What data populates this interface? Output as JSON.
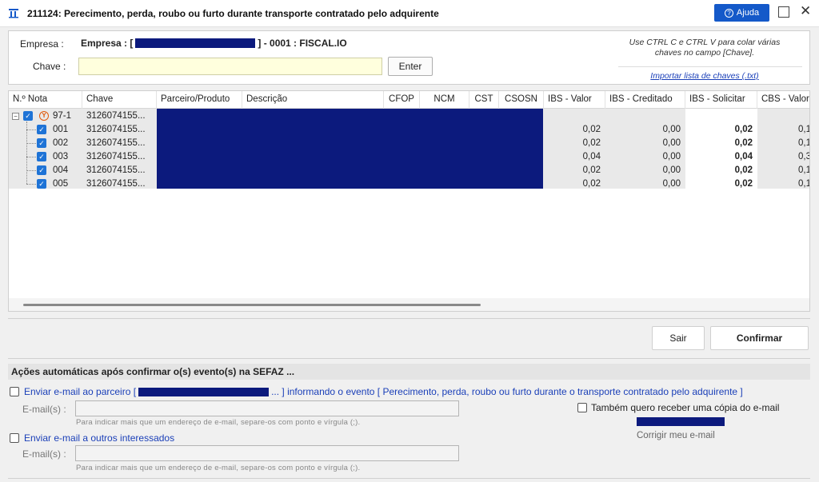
{
  "window": {
    "title": "211124: Perecimento, perda, roubo ou furto durante transporte contratado pelo adquirente",
    "help_label": "Ajuda",
    "close_glyph": "✕"
  },
  "header_panel": {
    "empresa_label": "Empresa :",
    "empresa_prefix": "Empresa : [",
    "empresa_suffix": "] - 0001 : FISCAL.IO",
    "chave_label": "Chave :",
    "chave_value": "",
    "enter_label": "Enter",
    "hint_line1": "Use CTRL C e CTRL V para colar várias",
    "hint_line2": "chaves no campo [Chave].",
    "import_link": "Importar lista de chaves (.txt)"
  },
  "grid": {
    "columns": [
      "N.º Nota",
      "Chave",
      "Parceiro/Produto",
      "Descrição",
      "CFOP",
      "NCM",
      "CST",
      "CSOSN",
      "IBS - Valor",
      "IBS - Creditado",
      "IBS - Solicitar",
      "CBS - Valor"
    ],
    "group": {
      "nota": "97-1",
      "chave": "3126074155..."
    },
    "rows": [
      {
        "nota": "001",
        "chave": "3126074155...",
        "ibs_valor": "0,02",
        "ibs_creditado": "0,00",
        "ibs_solicitar": "0,02",
        "cbs_valor": "0,1"
      },
      {
        "nota": "002",
        "chave": "3126074155...",
        "ibs_valor": "0,02",
        "ibs_creditado": "0,00",
        "ibs_solicitar": "0,02",
        "cbs_valor": "0,1"
      },
      {
        "nota": "003",
        "chave": "3126074155...",
        "ibs_valor": "0,04",
        "ibs_creditado": "0,00",
        "ibs_solicitar": "0,04",
        "cbs_valor": "0,3"
      },
      {
        "nota": "004",
        "chave": "3126074155...",
        "ibs_valor": "0,02",
        "ibs_creditado": "0,00",
        "ibs_solicitar": "0,02",
        "cbs_valor": "0,1"
      },
      {
        "nota": "005",
        "chave": "3126074155...",
        "ibs_valor": "0,02",
        "ibs_creditado": "0,00",
        "ibs_solicitar": "0,02",
        "cbs_valor": "0,1"
      }
    ]
  },
  "actions": {
    "sair_label": "Sair",
    "confirmar_label": "Confirmar"
  },
  "auto_actions": {
    "header": "Ações automáticas após confirmar o(s) evento(s) na SEFAZ ...",
    "opt1_prefix": "Enviar e-mail ao parceiro [",
    "opt1_suffix": "... ] informando o evento [ Perecimento, perda, roubo ou furto durante o transporte contratado pelo adquirente ]",
    "email_label": "E-mail(s) :",
    "email_hint": "Para indicar mais que um endereço de e-mail, separe-os com ponto e vírgula (;).",
    "copy_label": "Também quero receber uma cópia do e-mail",
    "fix_email": "Corrigir meu e-mail",
    "opt2_label": "Enviar e-mail a outros interessados",
    "email2_label": "E-mail(s) :",
    "email2_hint": "Para indicar mais que um endereço de e-mail, separe-os com ponto e vírgula (;)."
  },
  "colors": {
    "accent": "#1459c9",
    "redaction": "#0c1a7d",
    "checkbox": "#1e73d6",
    "link": "#1a3fb8",
    "key_field": "#ffffdd"
  }
}
